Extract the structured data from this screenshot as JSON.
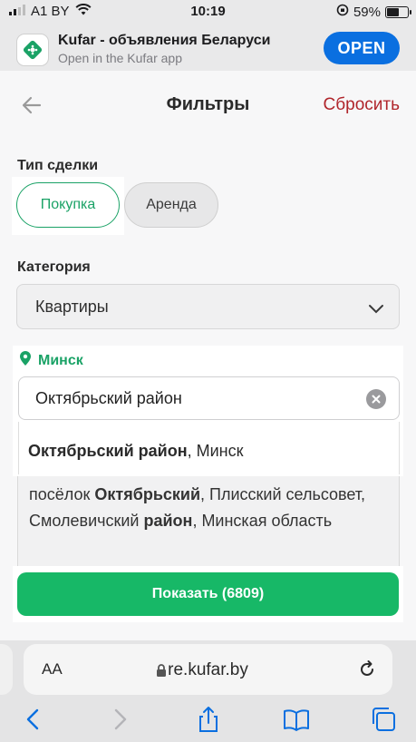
{
  "status_bar": {
    "carrier": "A1 BY",
    "time": "10:19",
    "battery": "59%",
    "battery_level": 0.59
  },
  "banner": {
    "title": "Kufar - объявления Беларуси",
    "subtitle": "Open in the Kufar app",
    "open_label": "OPEN"
  },
  "header": {
    "title": "Фильтры",
    "reset_label": "Сбросить"
  },
  "deal_type": {
    "label": "Тип сделки",
    "options": [
      "Покупка",
      "Аренда"
    ],
    "selected": "Покупка"
  },
  "category": {
    "label": "Категория",
    "value": "Квартиры"
  },
  "location": {
    "city": "Минск",
    "input_value": "Октябрьский район",
    "suggestions": [
      {
        "bold": "Октябрьский район",
        "rest": ", Минск"
      },
      {
        "parts": [
          "посёлок ",
          "Октябрьский",
          ", Плисский сельсовет, Смолевичский ",
          "район",
          ", Минская область"
        ]
      }
    ]
  },
  "show_button": {
    "label": "Показать (6809)"
  },
  "browser": {
    "aa_label": "AA",
    "url": "re.kufar.by"
  },
  "colors": {
    "accent": "#1aa266",
    "button": "#17b867",
    "reset": "#b0252b",
    "open": "#0a6fe0"
  }
}
